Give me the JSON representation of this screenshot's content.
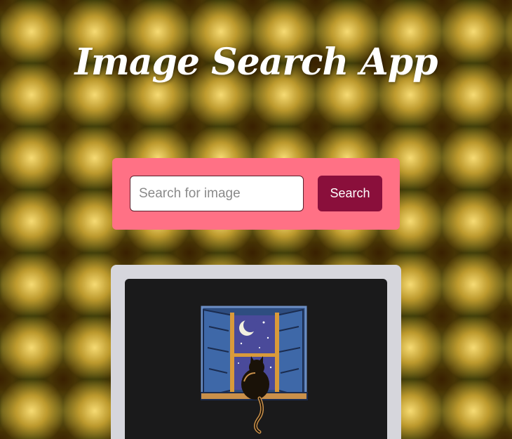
{
  "app": {
    "title": "Image Search App"
  },
  "search": {
    "placeholder": "Search for image",
    "value": "",
    "button_label": "Search"
  },
  "results": {
    "items": [
      {
        "kind": "illustration",
        "icon": "cat-at-night-window-illustration"
      }
    ]
  },
  "colors": {
    "search_panel": "#ff7185",
    "search_button": "#8a0f3b",
    "results_panel": "#d6d6dc",
    "image_card": "#1a1a1b"
  }
}
